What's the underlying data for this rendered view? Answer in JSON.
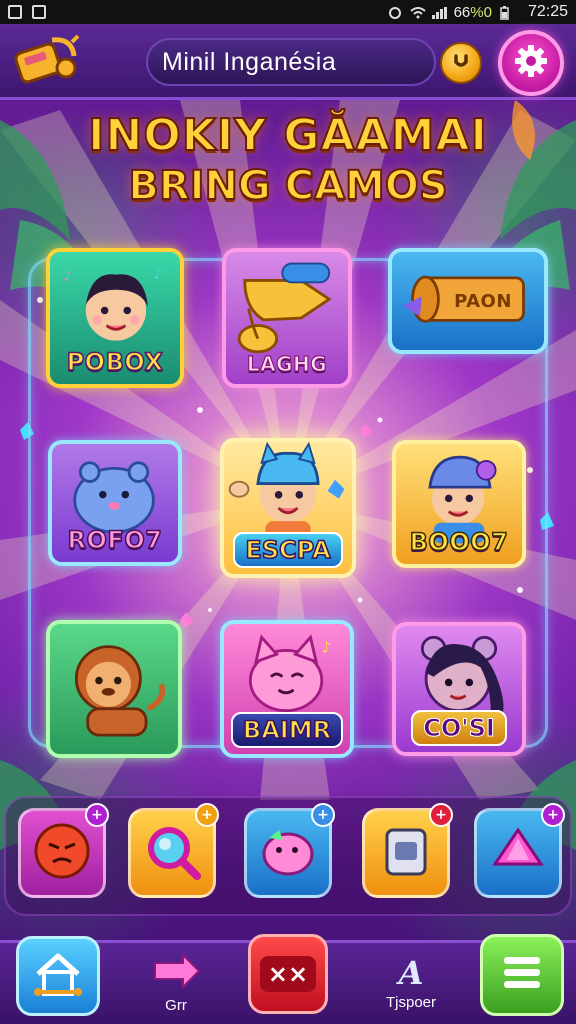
{
  "status_bar": {
    "battery_text": "66",
    "battery_suffix": "%0",
    "time": "72:25"
  },
  "header": {
    "title": "Minil Inganésia",
    "coin_icon": "coin-icon",
    "settings_icon": "gear-icon"
  },
  "game_title": {
    "line1": "INOKIY GĂAMAI",
    "line2": "BRING CAMOS"
  },
  "tiles": [
    {
      "label": "POBOX"
    },
    {
      "label": "LAGHG"
    },
    {
      "label": "PAON"
    },
    {
      "label": "ROFO7"
    },
    {
      "label": "ESCPA"
    },
    {
      "label": "BOOO7"
    },
    {
      "label": "BAIMR"
    },
    {
      "label": "CO'SI"
    }
  ],
  "items": [
    {
      "icon": "angry-face-icon",
      "badge": "+"
    },
    {
      "icon": "magnifier-icon",
      "badge": "+"
    },
    {
      "icon": "creature-icon",
      "badge": "+"
    },
    {
      "icon": "device-icon",
      "badge": "+"
    },
    {
      "icon": "gem-icon",
      "badge": "+"
    }
  ],
  "nav": {
    "home_icon": "home-icon",
    "gift_label": "Grr",
    "close_icon": "close-icon",
    "close_text": "××",
    "a_letter": "A",
    "a_label": "Tjspoer",
    "menu_icon": "menu-icon"
  },
  "colors": {
    "accent_yellow": "#ffd23a",
    "frame_cyan": "#82dcff",
    "settings_pink": "#ff4fd0",
    "close_red": "#e0203a",
    "menu_green": "#5ed03a"
  }
}
